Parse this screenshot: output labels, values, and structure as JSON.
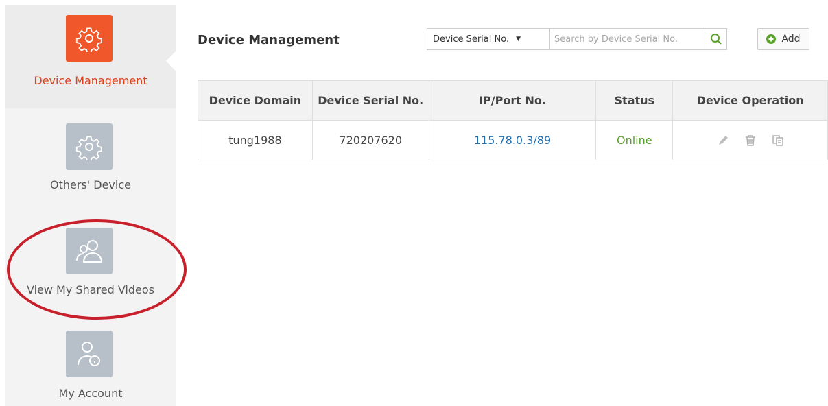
{
  "sidebar": {
    "items": [
      {
        "label": "Device Management",
        "icon": "gear-icon",
        "active": true
      },
      {
        "label": "Others' Device",
        "icon": "gear-icon",
        "active": false
      },
      {
        "label": "View My Shared Videos",
        "icon": "users-icon",
        "active": false
      },
      {
        "label": "My Account",
        "icon": "user-info-icon",
        "active": false
      }
    ]
  },
  "header": {
    "title": "Device Management",
    "filter_select_value": "Device Serial No.",
    "search_placeholder": "Search by Device Serial No.",
    "add_label": "Add"
  },
  "table": {
    "columns": [
      "Device Domain",
      "Device Serial No.",
      "IP/Port No.",
      "Status",
      "Device Operation"
    ],
    "rows": [
      {
        "domain": "tung1988",
        "serial": "720207620",
        "ip_port": "115.78.0.3/89",
        "status": "Online"
      }
    ]
  },
  "colors": {
    "accent": "#f0582b",
    "link": "#1f6fb2",
    "online": "#5aa02c",
    "annotation": "#c8202a"
  }
}
